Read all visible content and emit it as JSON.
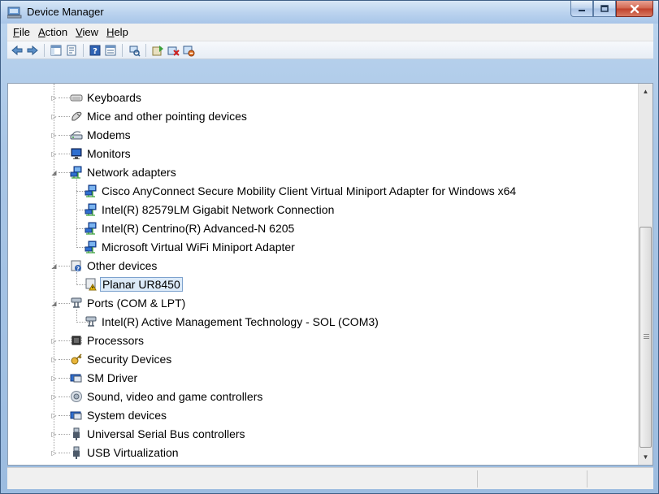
{
  "window": {
    "title": "Device Manager",
    "icon": "device-manager-icon"
  },
  "menu": [
    {
      "label": "File",
      "accel": "F",
      "rest": "ile"
    },
    {
      "label": "Action",
      "accel": "A",
      "rest": "ction"
    },
    {
      "label": "View",
      "accel": "V",
      "rest": "iew"
    },
    {
      "label": "Help",
      "accel": "H",
      "rest": "elp"
    }
  ],
  "toolbar": [
    "back-arrow-icon",
    "forward-arrow-icon",
    "show-hide-console-tree-icon",
    "properties-icon",
    "help-icon",
    "view-icon",
    "scan-hardware-icon",
    "update-driver-icon",
    "uninstall-device-icon",
    "disable-device-icon"
  ],
  "tree": [
    {
      "label": "Keyboards",
      "icon": "keyboard-icon",
      "level": 0,
      "expanded": false
    },
    {
      "label": "Mice and other pointing devices",
      "icon": "mouse-icon",
      "level": 0,
      "expanded": false
    },
    {
      "label": "Modems",
      "icon": "modem-icon",
      "level": 0,
      "expanded": false
    },
    {
      "label": "Monitors",
      "icon": "monitor-icon",
      "level": 0,
      "expanded": false
    },
    {
      "label": "Network adapters",
      "icon": "network-adapter-icon",
      "level": 0,
      "expanded": true
    },
    {
      "label": "Cisco AnyConnect Secure Mobility Client Virtual Miniport Adapter for Windows x64",
      "icon": "network-adapter-icon",
      "level": 1
    },
    {
      "label": "Intel(R) 82579LM Gigabit Network Connection",
      "icon": "network-adapter-icon",
      "level": 1
    },
    {
      "label": "Intel(R) Centrino(R) Advanced-N 6205",
      "icon": "network-adapter-icon",
      "level": 1
    },
    {
      "label": "Microsoft Virtual WiFi Miniport Adapter",
      "icon": "network-adapter-icon",
      "level": 1
    },
    {
      "label": "Other devices",
      "icon": "unknown-device-icon",
      "level": 0,
      "expanded": true
    },
    {
      "label": "Planar UR8450",
      "icon": "warning-device-icon",
      "level": 1,
      "selected": true
    },
    {
      "label": "Ports (COM & LPT)",
      "icon": "port-icon",
      "level": 0,
      "expanded": true
    },
    {
      "label": "Intel(R) Active Management Technology - SOL (COM3)",
      "icon": "port-icon",
      "level": 1
    },
    {
      "label": "Processors",
      "icon": "processor-icon",
      "level": 0,
      "expanded": false
    },
    {
      "label": "Security Devices",
      "icon": "security-device-icon",
      "level": 0,
      "expanded": false
    },
    {
      "label": "SM Driver",
      "icon": "system-device-icon",
      "level": 0,
      "expanded": false
    },
    {
      "label": "Sound, video and game controllers",
      "icon": "speaker-icon",
      "level": 0,
      "expanded": false
    },
    {
      "label": "System devices",
      "icon": "system-device-icon",
      "level": 0,
      "expanded": false
    },
    {
      "label": "Universal Serial Bus controllers",
      "icon": "usb-plug-icon",
      "level": 0,
      "expanded": false
    },
    {
      "label": "USB Virtualization",
      "icon": "usb-plug-icon",
      "level": 0,
      "expanded": false
    }
  ],
  "colors": {
    "title_bg": "#bcd4ef",
    "selection": "#dceaf8",
    "selection_border": "#7da2ce"
  }
}
